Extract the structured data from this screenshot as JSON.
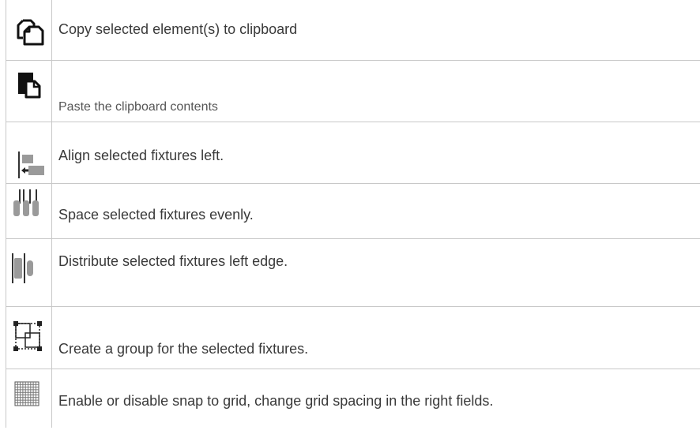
{
  "rows": [
    {
      "icon": "copy-icon",
      "text": "Copy selected element(s) to clipboard"
    },
    {
      "icon": "paste-icon",
      "text": "Paste the clipboard contents"
    },
    {
      "icon": "align-left-icon",
      "text": "Align selected fixtures left."
    },
    {
      "icon": "space-evenly-icon",
      "text": "Space selected fixtures evenly."
    },
    {
      "icon": "distribute-left-edge-icon",
      "text": "Distribute selected fixtures left edge."
    },
    {
      "icon": "group-icon",
      "text": "Create a group for the selected fixtures."
    },
    {
      "icon": "grid-icon",
      "text": "Enable or disable snap to grid, change grid spacing in the right fields."
    }
  ]
}
